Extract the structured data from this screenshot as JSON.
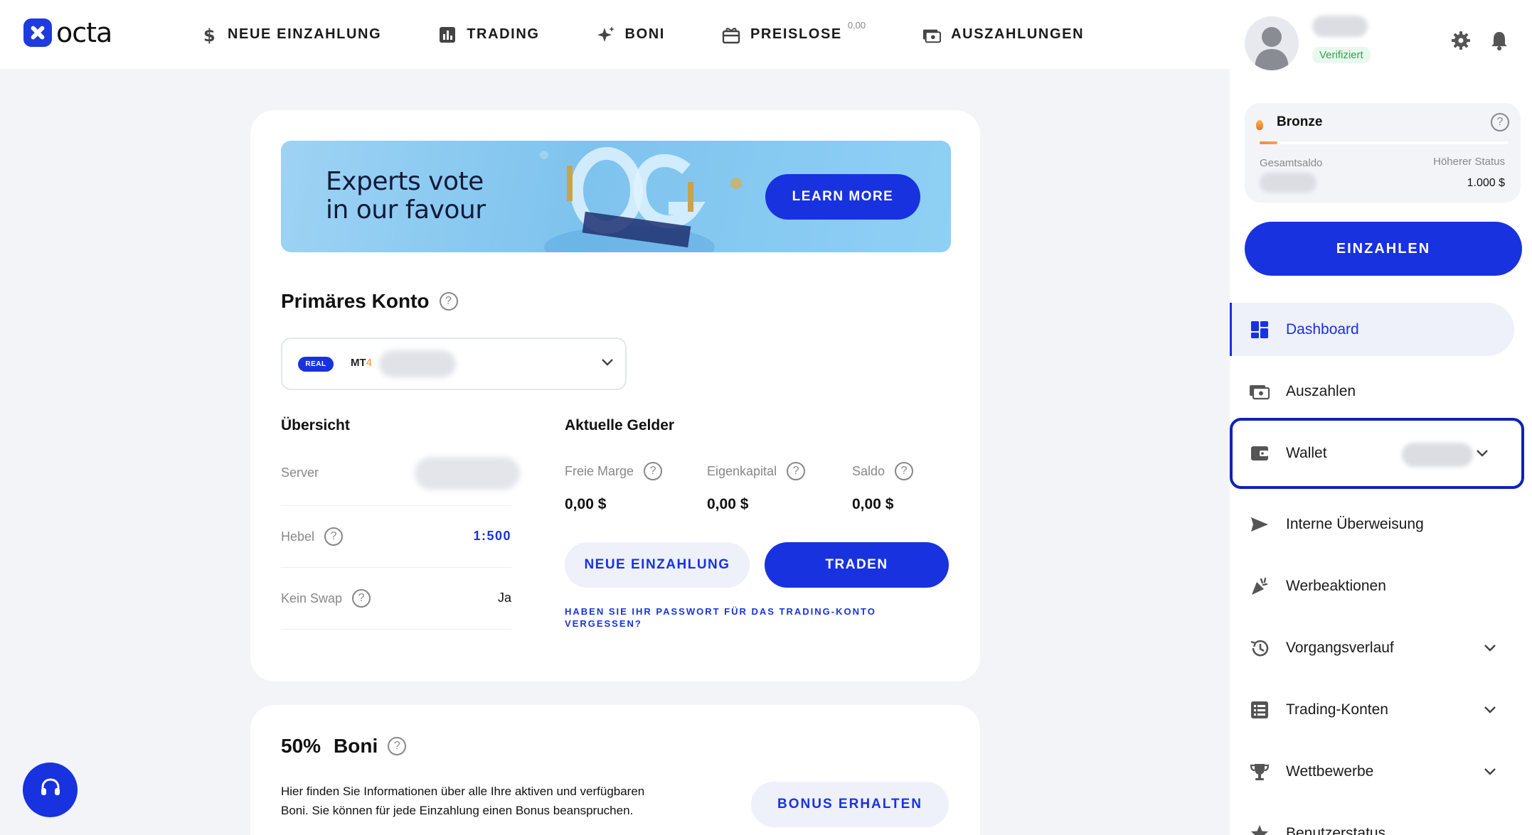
{
  "brand": {
    "name": "octa"
  },
  "nav": [
    {
      "label": "NEUE EINZAHLUNG",
      "icon": "dollar-icon"
    },
    {
      "label": "TRADING",
      "icon": "chart-icon"
    },
    {
      "label": "BONI",
      "icon": "sparkle-icon"
    },
    {
      "label": "PREISLOSE",
      "icon": "gift-icon",
      "badge": "0,00"
    },
    {
      "label": "AUSZAHLUNGEN",
      "icon": "cash-icon"
    }
  ],
  "profile": {
    "verified": "Verifiziert"
  },
  "status": {
    "level": "Bronze",
    "progress": 0.07,
    "total_label": "Gesamtsaldo",
    "next_label": "Höherer Status",
    "next_value": "1.000 $"
  },
  "deposit_button": "EINZAHLEN",
  "menu": [
    {
      "label": "Dashboard",
      "icon": "dashboard-icon",
      "active": true
    },
    {
      "label": "Auszahlen",
      "icon": "cash-icon"
    },
    {
      "label": "Wallet",
      "icon": "wallet-icon"
    },
    {
      "label": "Interne Überweisung",
      "icon": "send-icon"
    },
    {
      "label": "Werbeaktionen",
      "icon": "party-icon"
    },
    {
      "label": "Vorgangsverlauf",
      "icon": "history-icon"
    },
    {
      "label": "Trading-Konten",
      "icon": "list-icon"
    },
    {
      "label": "Wettbewerbe",
      "icon": "trophy-icon"
    },
    {
      "label": "Benutzerstatus",
      "icon": "star-icon"
    }
  ],
  "banner": {
    "line1": "Experts vote",
    "line2": "in our favour",
    "button": "LEARN MORE"
  },
  "primary_account": {
    "title": "Primäres Konto",
    "badge": "REAL",
    "platform": "MT",
    "platform_version": "4"
  },
  "overview": {
    "title": "Übersicht",
    "rows": [
      {
        "label": "Server"
      },
      {
        "label": "Hebel",
        "value": "1:500"
      },
      {
        "label": "Kein Swap",
        "value": "Ja"
      }
    ]
  },
  "funds": {
    "title": "Aktuelle Gelder",
    "items": [
      {
        "label": "Freie Marge",
        "value": "0,00 $"
      },
      {
        "label": "Eigenkapital",
        "value": "0,00 $"
      },
      {
        "label": "Saldo",
        "value": "0,00 $"
      }
    ],
    "deposit_button": "NEUE EINZAHLUNG",
    "trade_button": "TRADEN",
    "forgot_line1": "HABEN SIE IHR PASSWORT FÜR DAS TRADING-KONTO",
    "forgot_line2": "VERGESSEN?"
  },
  "bonus": {
    "title_pct": "50%",
    "title": "Boni",
    "line1": "Hier finden Sie Informationen über alle Ihre aktiven und verfügbaren",
    "line2": "Boni. Sie können für jede Einzahlung einen Bonus beanspruchen.",
    "button": "BONUS ERHALTEN"
  }
}
